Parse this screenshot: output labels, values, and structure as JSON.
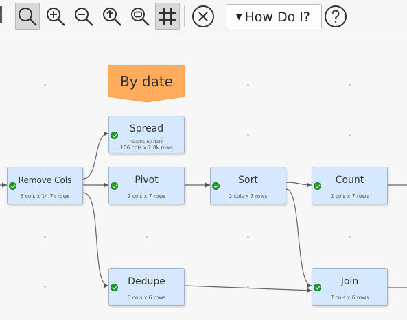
{
  "toolbar": {
    "buttons": [
      {
        "name": "zoom-select-button",
        "icon": "magnifier-icon",
        "active": true
      },
      {
        "name": "zoom-in-button",
        "icon": "zoom-in-icon"
      },
      {
        "name": "zoom-out-button",
        "icon": "zoom-out-icon"
      },
      {
        "name": "zoom-fit-button",
        "icon": "fit-arrow-icon"
      },
      {
        "name": "zoom-reset-button",
        "icon": "zoom-window-icon"
      },
      {
        "name": "grid-toggle-button",
        "icon": "grid-icon",
        "active": true
      },
      {
        "name": "clear-button",
        "icon": "circle-x-icon"
      },
      {
        "name": "help-button",
        "icon": "question-circle-icon"
      }
    ],
    "howdo_label": "How Do I?"
  },
  "annotation": {
    "label": "By date",
    "color": "#ffad5c"
  },
  "nodes": {
    "remove_cols": {
      "title": "Remove Cols",
      "sub": "6 cols x 14.7k rows",
      "status": "ok"
    },
    "spread": {
      "title": "Spread",
      "note": "deaths by date",
      "sub": "106 cols x 2.8k rows",
      "status": "ok"
    },
    "pivot": {
      "title": "Pivot",
      "sub": "2 cols x 7 rows",
      "status": "ok"
    },
    "sort": {
      "title": "Sort",
      "sub": "2 cols x 7 rows",
      "status": "ok"
    },
    "count": {
      "title": "Count",
      "sub": "2 cols x 7 rows",
      "status": "ok"
    },
    "dedupe": {
      "title": "Dedupe",
      "sub": "6 cols x 6 rows",
      "status": "ok"
    },
    "join": {
      "title": "Join",
      "sub": "7 cols x 6 rows",
      "status": "ok"
    }
  },
  "colors": {
    "node_fill": "#d6e8fb",
    "node_border": "#9fb4cc",
    "status_ok": "#1f9e2c",
    "edge": "#555555"
  }
}
